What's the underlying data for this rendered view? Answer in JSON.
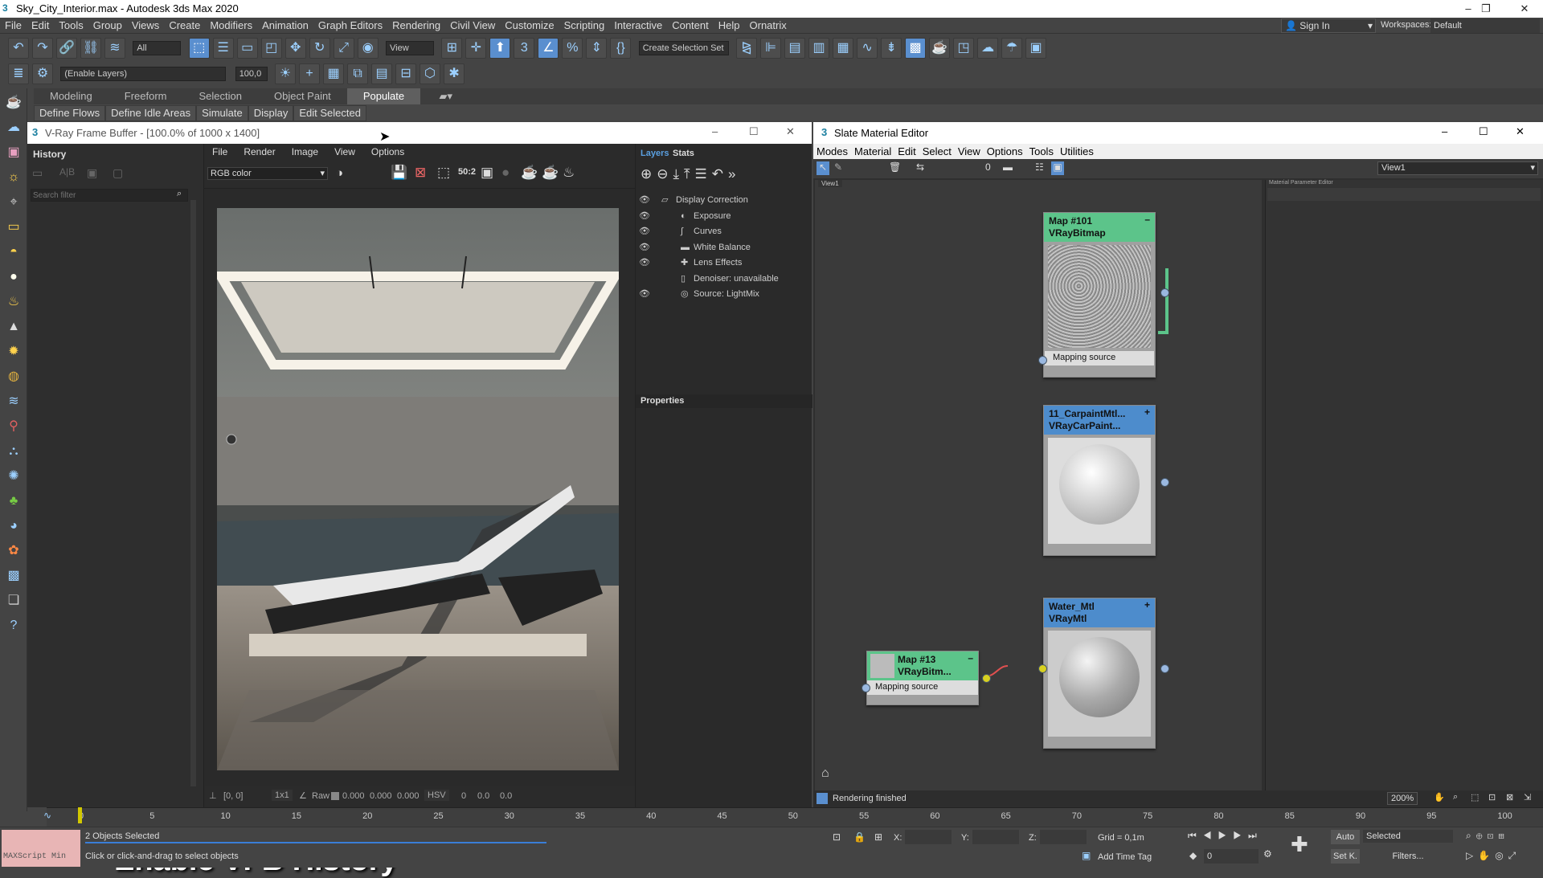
{
  "app": {
    "title": "Sky_City_Interior.max - Autodesk 3ds Max 2020"
  },
  "menu": [
    "File",
    "Edit",
    "Tools",
    "Group",
    "Views",
    "Create",
    "Modifiers",
    "Animation",
    "Graph Editors",
    "Rendering",
    "Civil View",
    "Customize",
    "Scripting",
    "Interactive",
    "Content",
    "Help",
    "Ornatrix"
  ],
  "signin": "Sign In",
  "workspaces_label": "Workspaces:",
  "workspaces_value": "Default",
  "toolbar": {
    "filter": "All",
    "view": "View",
    "selset": "Create Selection Set",
    "layer_field": "(Enable Layers)",
    "layer_value": "100,0"
  },
  "ribbon_tabs": [
    "Modeling",
    "Freeform",
    "Selection",
    "Object Paint",
    "Populate"
  ],
  "ribbon_buttons": [
    "Define Flows",
    "Define Idle Areas",
    "Simulate",
    "Display",
    "Edit Selected"
  ],
  "vfb": {
    "title": "V-Ray Frame Buffer - [100.0% of 1000 x 1400]",
    "history": "History",
    "search": "Search filter",
    "menu": [
      "File",
      "Render",
      "Image",
      "View",
      "Options"
    ],
    "channel": "RGB color",
    "zoom_btn": "50:2",
    "status": {
      "coords": "[0, 0]",
      "ratio": "1x1",
      "raw": "Raw",
      "r": "0.000",
      "g": "0.000",
      "b": "0.000",
      "mode": "HSV",
      "h": "0",
      "s": "0.0",
      "v": "0.0"
    },
    "layers_tab": "Layers",
    "stats_tab": "Stats",
    "layers": [
      "Display Correction",
      "Exposure",
      "Curves",
      "White Balance",
      "Lens Effects",
      "Denoiser: unavailable",
      "Source: LightMix"
    ],
    "properties": "Properties"
  },
  "caption": "Enable VFB History",
  "slate": {
    "title": "Slate Material Editor",
    "menu": [
      "Modes",
      "Material",
      "Edit",
      "Select",
      "View",
      "Options",
      "Tools",
      "Utilities"
    ],
    "view": "View1",
    "tab": "View1",
    "param_title": "Material Parameter Editor",
    "status": "Rendering finished",
    "zoom": "200%",
    "nodes": [
      {
        "name": "Map #101",
        "type": "VRayBitmap",
        "slot": "Mapping source"
      },
      {
        "name": "11_CarpaintMtl...",
        "type": "VRayCarPaint..."
      },
      {
        "name": "Water_Mtl",
        "type": "VRayMtl"
      },
      {
        "name": "Map #13",
        "type": "VRayBitm...",
        "slot": "Mapping source"
      }
    ]
  },
  "timeline": {
    "ticks": [
      "0",
      "5",
      "10",
      "15",
      "20",
      "25",
      "30",
      "35",
      "40",
      "45",
      "50",
      "55",
      "60",
      "65",
      "70",
      "75",
      "80",
      "85",
      "90",
      "95",
      "100"
    ]
  },
  "bottom": {
    "maxscript": "MAXScript Min",
    "selected": "2 Objects Selected",
    "prompt": "Click or click-and-drag to select objects",
    "x": "X:",
    "y": "Y:",
    "z": "Z:",
    "grid": "Grid = 0,1m",
    "addtime": "Add Time Tag",
    "auto": "Auto",
    "setk": "Set K.",
    "selected_dd": "Selected",
    "filters": "Filters...",
    "frame": "0"
  },
  "colors": {
    "accent": "#5a8fcf",
    "map_node": "#5cc48a",
    "mtl_node": "#4d8ccc",
    "wire": "#e05050"
  }
}
